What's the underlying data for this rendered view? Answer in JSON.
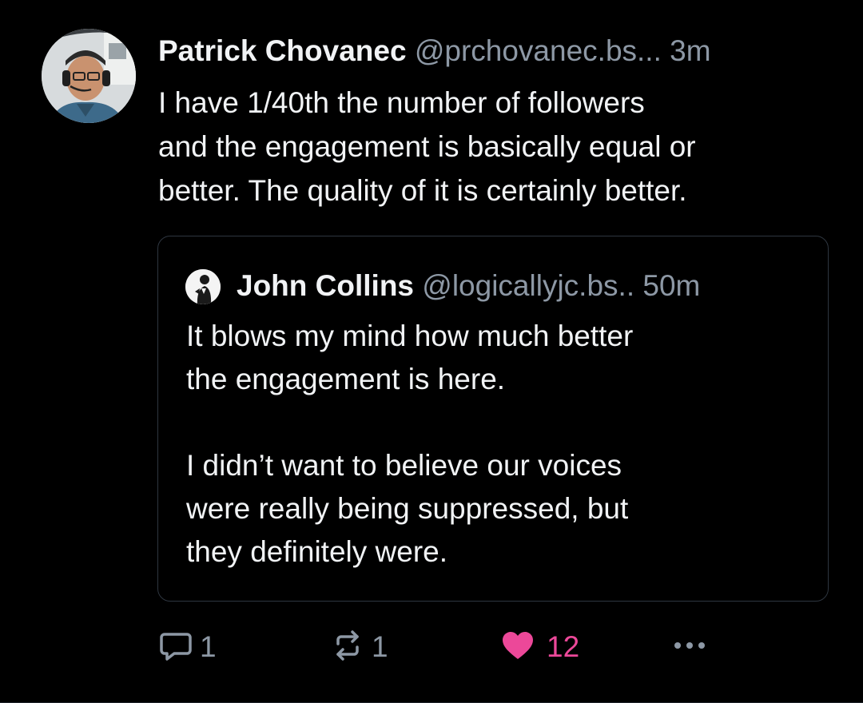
{
  "post": {
    "author": {
      "display_name": "Patrick Chovanec",
      "handle": "@prchovanec.bs...",
      "avatar_icon": "user-avatar-photo"
    },
    "timestamp": "3m",
    "text": "I have 1/40th the number of followers\nand the engagement is basically equal or\nbetter. The quality of it is certainly better.",
    "quote": {
      "author": {
        "display_name": "John Collins",
        "handle": "@logicallyjc.bs..",
        "avatar_icon": "user-avatar-silhouette"
      },
      "timestamp": "50m",
      "text": "It blows my mind how much better\nthe engagement is here.\n\nI didn’t want to believe our voices\nwere really being suppressed, but\nthey definitely were."
    },
    "actions": {
      "reply_count": "1",
      "repost_count": "1",
      "like_count": "12",
      "liked": true
    }
  },
  "colors": {
    "background": "#000000",
    "text_primary": "#f1f3f5",
    "text_secondary": "#8d98a5",
    "like_active": "#ec4899",
    "border": "#2e3640"
  }
}
